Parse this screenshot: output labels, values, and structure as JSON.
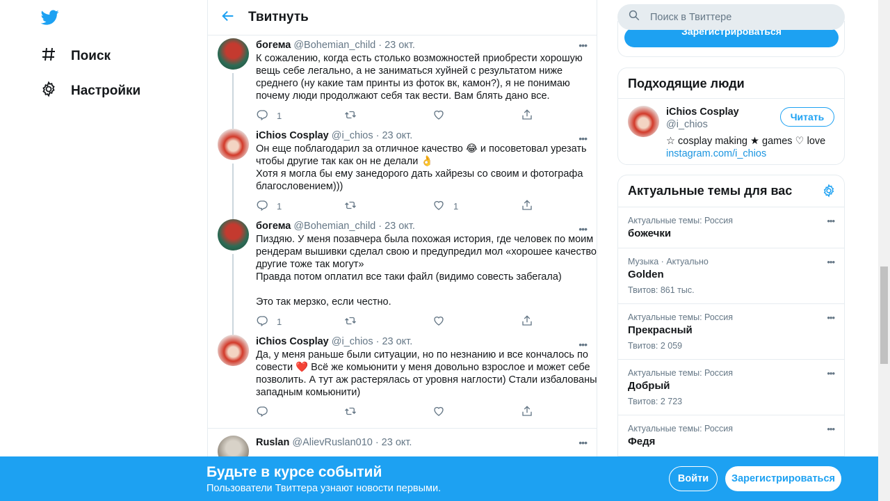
{
  "nav": {
    "logo_icon": "twitter-bird-icon",
    "items": [
      {
        "label": "Поиск",
        "icon": "hash-icon"
      },
      {
        "label": "Настройки",
        "icon": "gear-icon"
      }
    ]
  },
  "header": {
    "title": "Твитнуть"
  },
  "tweets": [
    {
      "name": "богема",
      "handle": "@Bohemian_child",
      "date": "23 окт.",
      "text": "К сожалению, когда есть столько возможностей приобрести хорошую\nвещь себе легально, а не заниматься хуйней с результатом ниже\nсреднего (ну какие там принты из фоток вк, камон?), я не понимаю\nпочему люди продолжают себя так вести. Вам блять дано все.",
      "replies": "1",
      "retweets": "",
      "likes": ""
    },
    {
      "name": "iChios Cosplay",
      "handle": "@i_chios",
      "date": "23 окт.",
      "text": "Он еще поблагодарил за отличное качество 😂 и посоветовал урезать\nчтобы другие так как он не делали 👌\nХотя я могла бы ему занедорого дать хайрезы со своим и фотографа\nблагословением)))",
      "replies": "1",
      "retweets": "",
      "likes": "1"
    },
    {
      "name": "богема",
      "handle": "@Bohemian_child",
      "date": "23 окт.",
      "text": "Пиздяю. У меня позавчера была похожая история, где человек по моим\nрендерам вышивки сделал свою и предупредил мол «хорошее качество,\nдругие тоже так могут»\nПравда потом оплатил все таки файл (видимо совесть забегала)\n\nЭто так мерзко, если честно.",
      "replies": "1",
      "retweets": "",
      "likes": ""
    },
    {
      "name": "iChios Cosplay",
      "handle": "@i_chios",
      "date": "23 окт.",
      "text": "Да, у меня раньше были ситуации, но по незнанию и все кончалось по\nсовести ❤️ Всё же комьюнити у меня довольно взрослое и может себе\nпозволить. А тут аж растерялась от уровня наглости) Стали избалованы\nзападным комьюнити)",
      "replies": "",
      "retweets": "",
      "likes": ""
    },
    {
      "name": "Ruslan",
      "handle": "@AlievRuslan010",
      "date": "23 окт.",
      "text": "",
      "replies": "",
      "retweets": "",
      "likes": ""
    }
  ],
  "search": {
    "placeholder": "Поиск в Твиттере"
  },
  "signup_small": "Зарегистрироваться",
  "people": {
    "title": "Подходящие люди",
    "name": "iChios Cosplay",
    "handle": "@i_chios",
    "bio": "☆ cosplay making ★ games ♡ love",
    "link": "instagram.com/i_chios",
    "follow": "Читать"
  },
  "trends": {
    "title": "Актуальные темы для вас",
    "items": [
      {
        "category": "Актуальные темы: Россия",
        "name": "божечки",
        "count": ""
      },
      {
        "category": "Музыка · Актуально",
        "name": "Golden",
        "count": "Твитов: 861 тыс."
      },
      {
        "category": "Актуальные темы: Россия",
        "name": "Прекрасный",
        "count": "Твитов: 2 059"
      },
      {
        "category": "Актуальные темы: Россия",
        "name": "Добрый",
        "count": "Твитов: 2 723"
      },
      {
        "category": "Актуальные темы: Россия",
        "name": "Федя",
        "count": ""
      }
    ]
  },
  "banner": {
    "title": "Будьте в курсе событий",
    "subtitle": "Пользователи Твиттера узнают новости первыми.",
    "login": "Войти",
    "signup": "Зарегистрироваться"
  },
  "colors": {
    "accent": "#1da1f2",
    "secondary_text": "#657786",
    "border": "#e6ecf0"
  }
}
